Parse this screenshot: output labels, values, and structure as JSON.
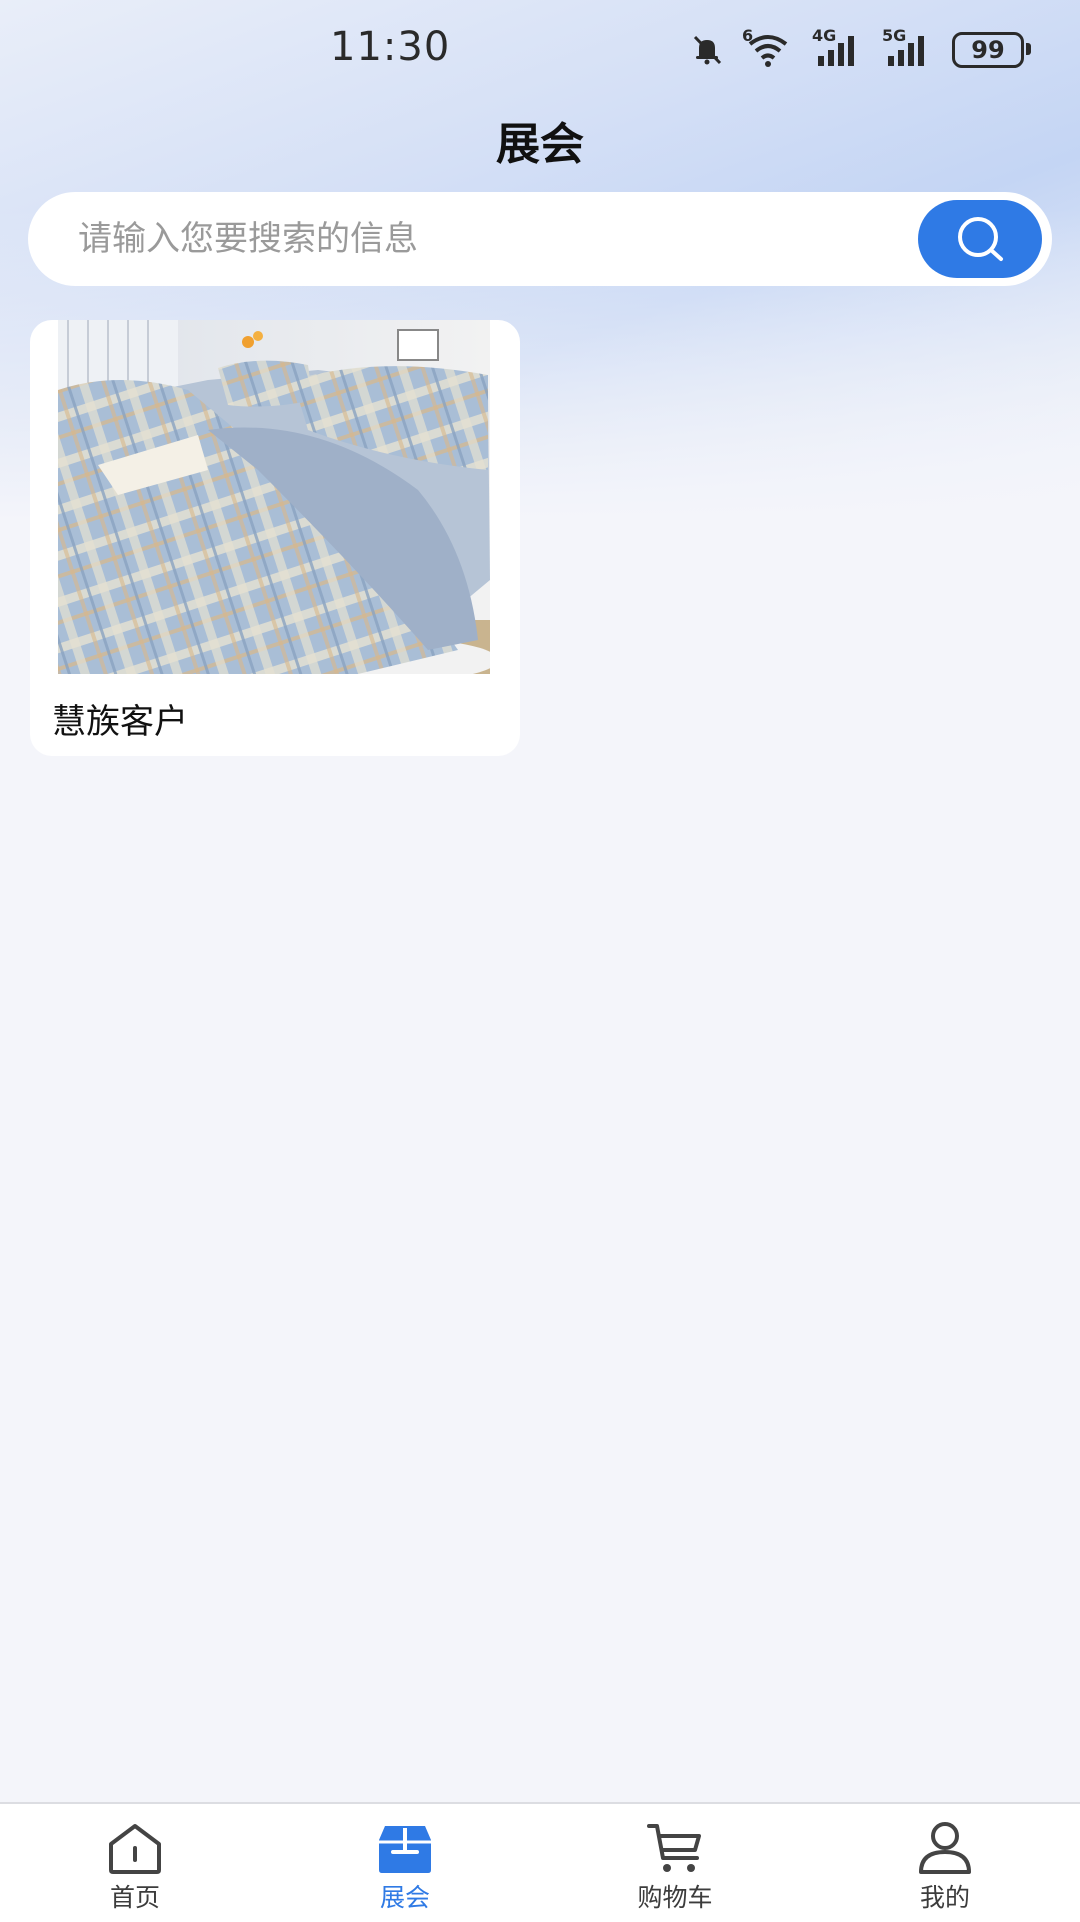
{
  "status_bar": {
    "time": "11:30",
    "signal_labels": [
      "6",
      "4G",
      "5G"
    ],
    "battery": "99",
    "icons": [
      "mute-bell-icon",
      "wifi-icon",
      "cellular-4g-icon",
      "cellular-5g-icon",
      "battery-icon"
    ]
  },
  "header": {
    "title": "展会"
  },
  "search": {
    "placeholder": "请输入您要搜索的信息",
    "button_icon": "search-icon",
    "accent_color": "#2f7ae5"
  },
  "cards": [
    {
      "title": "慧族客户",
      "image": "plaid-bedding-photo"
    }
  ],
  "bottom_nav": {
    "active_index": 1,
    "active_color": "#2f7ae5",
    "items": [
      {
        "label": "首页",
        "icon": "home-icon"
      },
      {
        "label": "展会",
        "icon": "exhibition-box-icon"
      },
      {
        "label": "购物车",
        "icon": "cart-icon"
      },
      {
        "label": "我的",
        "icon": "user-icon"
      }
    ]
  }
}
